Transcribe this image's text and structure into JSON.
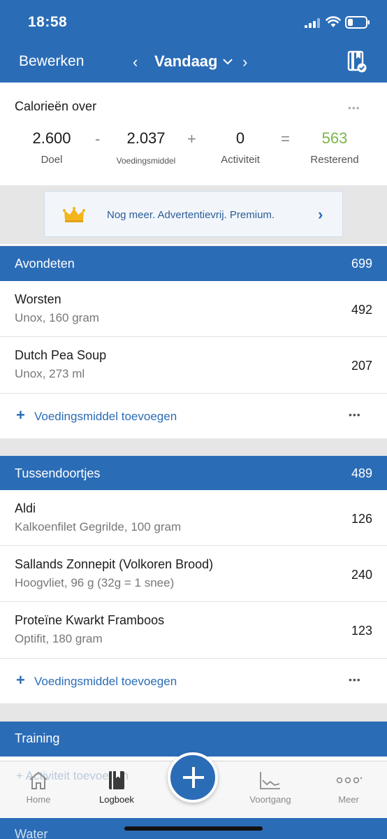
{
  "status": {
    "time": "18:58"
  },
  "nav": {
    "edit": "Bewerken",
    "prev": "‹",
    "date": "Vandaag",
    "next": "›"
  },
  "calories": {
    "title": "Calorieën over",
    "more": "•••",
    "goal_value": "2.600",
    "goal_label": "Doel",
    "op_minus": "-",
    "food_value": "2.037",
    "food_label": "Voedingsmiddel",
    "op_plus": "+",
    "activity_value": "0",
    "activity_label": "Activiteit",
    "op_equals": "=",
    "remaining_value": "563",
    "remaining_label": "Resterend",
    "remaining_color": "#7ab648"
  },
  "premium": {
    "text": "Nog meer. Advertentievrij. Premium.",
    "arrow": "›"
  },
  "sections": {
    "dinner": {
      "name": "Avondeten",
      "total": "699",
      "items": [
        {
          "title": "Worsten",
          "sub": "Unox, 160 gram",
          "cal": "492"
        },
        {
          "title": "Dutch Pea Soup",
          "sub": "Unox, 273 ml",
          "cal": "207"
        }
      ],
      "add_label": "Voedingsmiddel toevoegen",
      "add_plus": "+",
      "more": "•••"
    },
    "snacks": {
      "name": "Tussendoortjes",
      "total": "489",
      "items": [
        {
          "title": "Aldi",
          "sub": "Kalkoenfilet Gegrilde, 100 gram",
          "cal": "126"
        },
        {
          "title": "Sallands Zonnepit (Volkoren Brood)",
          "sub": "Hoogvliet, 96 g (32g = 1 snee)",
          "cal": "240"
        },
        {
          "title": "Proteïne Kwarkt Framboos",
          "sub": "Optifit, 180 gram",
          "cal": "123"
        }
      ],
      "add_label": "Voedingsmiddel toevoegen",
      "add_plus": "+",
      "more": "•••"
    },
    "training": {
      "name": "Training",
      "add_ghost": "+ Activiteit toevoegen"
    },
    "water": {
      "name": "Water"
    }
  },
  "tabs": [
    {
      "label": "Home",
      "icon": "home-icon"
    },
    {
      "label": "Logboek",
      "icon": "logbook-icon"
    },
    {
      "label": "Voortgang",
      "icon": "progress-chart-icon"
    },
    {
      "label": "Meer",
      "icon": "more-dots-icon"
    }
  ],
  "colors": {
    "brand_blue": "#2b6cb6",
    "remaining_green": "#7ab648"
  }
}
